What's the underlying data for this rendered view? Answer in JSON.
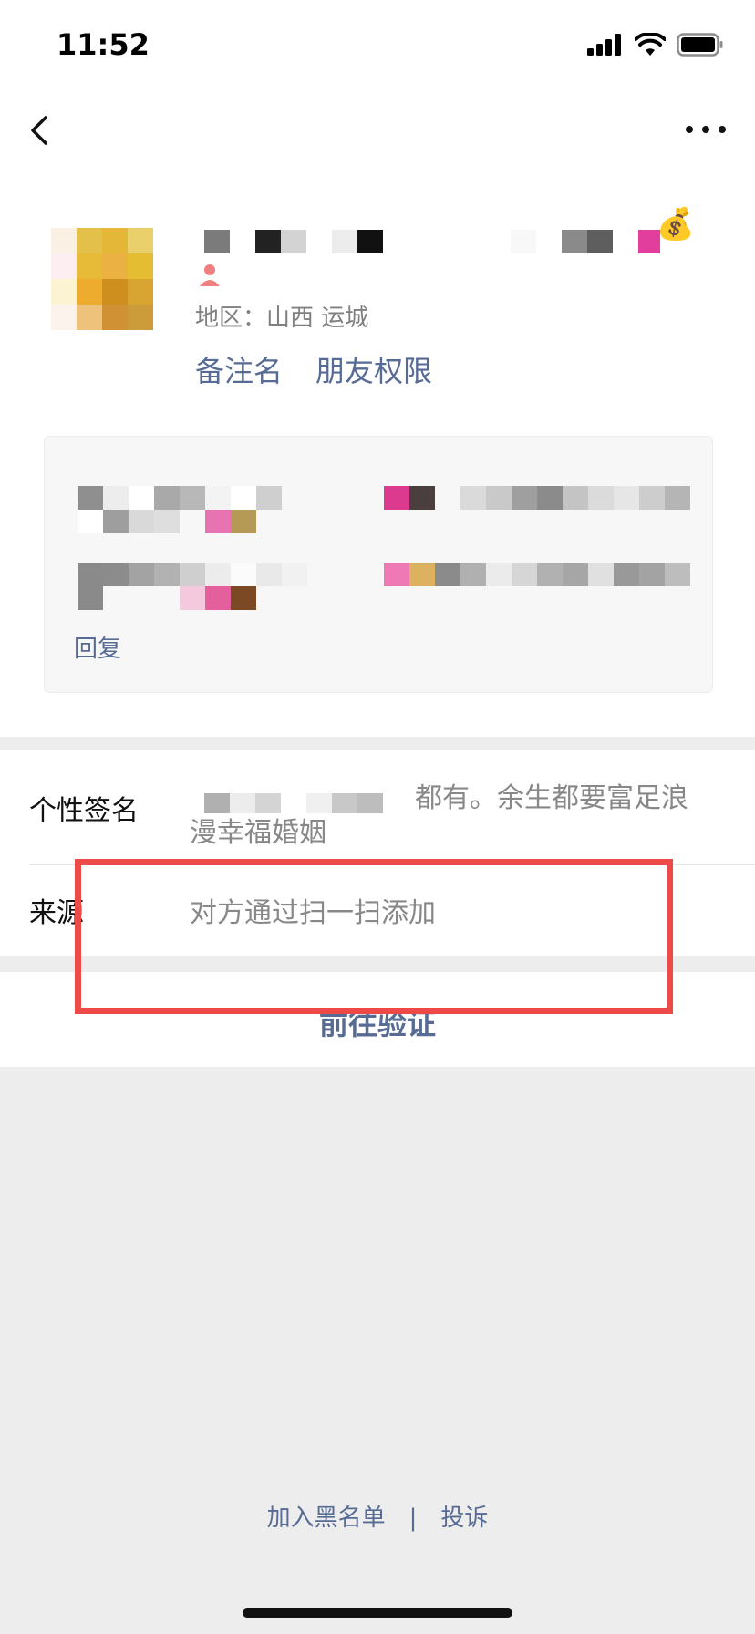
{
  "status_bar": {
    "time": "11:52"
  },
  "nav": {
    "back_icon": "chevron-left-icon",
    "more_icon": "more-dots-icon"
  },
  "profile": {
    "region": "地区：山西 运城",
    "remark_label": "备注名",
    "permission_label": "朋友权限",
    "money_emoji": "💰"
  },
  "moment": {
    "reply_label": "回复"
  },
  "info": {
    "signature_label": "个性签名",
    "signature_line1": "都有。余生都要富足浪",
    "signature_line2": "漫幸福婚姻",
    "source_label": "来源",
    "source_value": "对方通过扫一扫添加"
  },
  "verify": {
    "label": "前往验证"
  },
  "footer": {
    "blacklist": "加入黑名单",
    "separator": "|",
    "report": "投诉"
  },
  "colors": {
    "link": "#576b95",
    "highlight": "#ee4a4a",
    "page_bg": "#ededed"
  }
}
